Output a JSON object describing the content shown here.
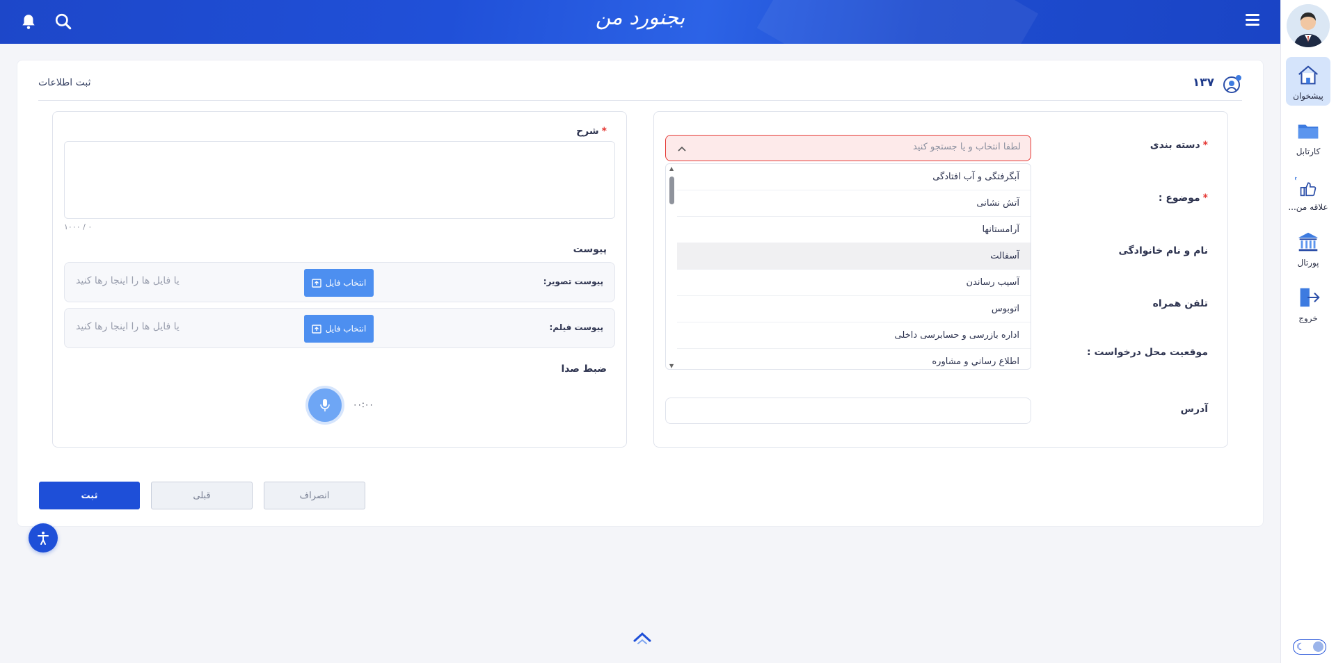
{
  "header": {
    "logo": "بجنورد من"
  },
  "sidebar": {
    "items": [
      {
        "label": "پیشخوان",
        "icon": "home-icon",
        "active": true
      },
      {
        "label": "کارتابل",
        "icon": "folder-icon",
        "active": false
      },
      {
        "label": "علاقه من...",
        "icon": "thumbs-up-stars-icon",
        "active": false
      },
      {
        "label": "پورتال",
        "icon": "bank-icon",
        "active": false
      },
      {
        "label": "خروج",
        "icon": "logout-icon",
        "active": false
      }
    ]
  },
  "card": {
    "title": "ثبت اطلاعات",
    "code": "۱۳۷"
  },
  "form": {
    "category_label": "دسته بندی",
    "category_placeholder": "لطفا انتخاب و یا جستجو کنید",
    "subject_label": "موضوع :",
    "name_label": "نام و نام خانوادگی",
    "phone_label": "تلفن همراه",
    "location_label": "موقعیت محل درخواست :",
    "address_label": "آدرس",
    "required_mark": "*",
    "options": [
      "آبگرفتگی و آب افتادگی",
      "آتش نشانی",
      "آرامستانها",
      "آسفالت",
      "آسیب رساندن",
      "اتوبوس",
      "اداره بازرسی و حسابرسی داخلی",
      "اطلاع رساني و مشاوره"
    ],
    "highlighted_option": 3
  },
  "details": {
    "description_label": "شرح",
    "counter": "۰ / ۱۰۰۰",
    "attachments_label": "پیوست",
    "image_attachment_label": "پیوست تصویر:",
    "video_attachment_label": "پیوست فیلم:",
    "choose_file": "انتخاب فایل",
    "drop_placeholder": "یا فایل ها را اینجا رها کنید",
    "voice_label": "ضبط صدا",
    "timer": "۰۰:۰۰"
  },
  "actions": {
    "submit": "ثبت",
    "previous": "قبلی",
    "cancel": "انصراف"
  },
  "colors": {
    "primary": "#1e4fd8",
    "required": "#e53935",
    "error_bg": "#fdeaea"
  }
}
